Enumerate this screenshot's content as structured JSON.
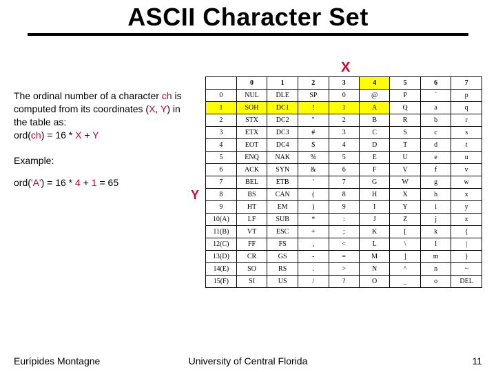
{
  "title": "ASCII Character Set",
  "left": {
    "line1a": "The ordinal number of a character ",
    "line1b": "ch",
    "line1c": " is computed from its coordinates (",
    "line1d": "X",
    "line1e": ", ",
    "line1f": "Y",
    "line1g": ") in the table as:",
    "line2a": "ord(",
    "line2b": "ch",
    "line2c": ") = 16 * ",
    "line2d": "X",
    "line2e": " + ",
    "line2f": "Y",
    "example_label": "Example:",
    "ex_a": "ord(",
    "ex_b": "'A'",
    "ex_c": ") = 16 * ",
    "ex_d": "4",
    "ex_e": " + ",
    "ex_f": "1",
    "ex_g": " = 65"
  },
  "axis": {
    "x": "X",
    "y": "Y"
  },
  "table": {
    "col_headers": [
      "0",
      "1",
      "2",
      "3",
      "4",
      "5",
      "6",
      "7"
    ],
    "rows": [
      {
        "h": "0",
        "c": [
          "NUL",
          "DLE",
          "SP",
          "0",
          "@",
          "P",
          "`",
          "p"
        ]
      },
      {
        "h": "1",
        "c": [
          "SOH",
          "DC1",
          "!",
          "1",
          "A",
          "Q",
          "a",
          "q"
        ],
        "hl": true
      },
      {
        "h": "2",
        "c": [
          "STX",
          "DC2",
          "\"",
          "2",
          "B",
          "R",
          "b",
          "r"
        ]
      },
      {
        "h": "3",
        "c": [
          "ETX",
          "DC3",
          "#",
          "3",
          "C",
          "S",
          "c",
          "s"
        ]
      },
      {
        "h": "4",
        "c": [
          "EOT",
          "DC4",
          "$",
          "4",
          "D",
          "T",
          "d",
          "t"
        ]
      },
      {
        "h": "5",
        "c": [
          "ENQ",
          "NAK",
          "%",
          "5",
          "E",
          "U",
          "e",
          "u"
        ]
      },
      {
        "h": "6",
        "c": [
          "ACK",
          "SYN",
          "&",
          "6",
          "F",
          "V",
          "f",
          "v"
        ]
      },
      {
        "h": "7",
        "c": [
          "BEL",
          "ETB",
          "'",
          "7",
          "G",
          "W",
          "g",
          "w"
        ]
      },
      {
        "h": "8",
        "c": [
          "BS",
          "CAN",
          "(",
          "8",
          "H",
          "X",
          "h",
          "x"
        ]
      },
      {
        "h": "9",
        "c": [
          "HT",
          "EM",
          ")",
          "9",
          "I",
          "Y",
          "i",
          "y"
        ]
      },
      {
        "h": "10(A)",
        "c": [
          "LF",
          "SUB",
          "*",
          ":",
          "J",
          "Z",
          "j",
          "z"
        ]
      },
      {
        "h": "11(B)",
        "c": [
          "VT",
          "ESC",
          "+",
          ";",
          "K",
          "[",
          "k",
          "{"
        ]
      },
      {
        "h": "12(C)",
        "c": [
          "FF",
          "FS",
          ",",
          "<",
          "L",
          "\\",
          "l",
          "|"
        ]
      },
      {
        "h": "13(D)",
        "c": [
          "CR",
          "GS",
          "-",
          "=",
          "M",
          "]",
          "m",
          "}"
        ]
      },
      {
        "h": "14(E)",
        "c": [
          "SO",
          "RS",
          ".",
          ">",
          "N",
          "^",
          "n",
          "~"
        ]
      },
      {
        "h": "15(F)",
        "c": [
          "SI",
          "US",
          "/",
          "?",
          "O",
          "_",
          "o",
          "DEL"
        ]
      }
    ],
    "hl_col": 4
  },
  "footer": {
    "author": "Eurípides Montagne",
    "org": "University of Central Florida",
    "page": "11"
  }
}
